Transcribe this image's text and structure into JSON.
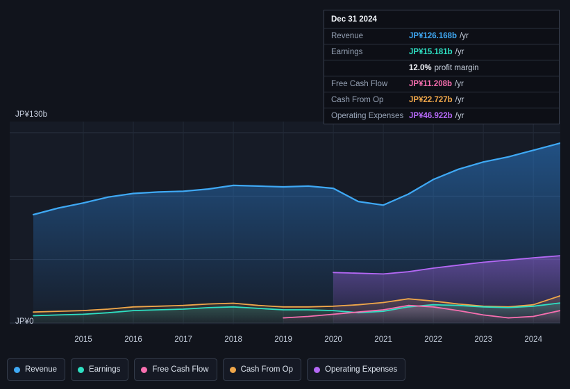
{
  "axis": {
    "y_top_label": "JP¥130b",
    "y_bottom_label": "JP¥0",
    "x_ticks": [
      "2015",
      "2016",
      "2017",
      "2018",
      "2019",
      "2020",
      "2021",
      "2022",
      "2023",
      "2024"
    ]
  },
  "tooltip": {
    "date": "Dec 31 2024",
    "rows": [
      {
        "label": "Revenue",
        "value": "JP¥126.168b",
        "unit": "/yr",
        "color": "#3fa9f5"
      },
      {
        "label": "Earnings",
        "value": "JP¥15.181b",
        "unit": "/yr",
        "color": "#2ee0c3"
      },
      {
        "label": "",
        "value": "12.0%",
        "unit": "profit margin",
        "color": "#f2f5fa"
      },
      {
        "label": "Free Cash Flow",
        "value": "JP¥11.208b",
        "unit": "/yr",
        "color": "#f86fb0"
      },
      {
        "label": "Cash From Op",
        "value": "JP¥22.727b",
        "unit": "/yr",
        "color": "#f0a74a"
      },
      {
        "label": "Operating Expenses",
        "value": "JP¥46.922b",
        "unit": "/yr",
        "color": "#b468f5"
      }
    ]
  },
  "legend": [
    {
      "label": "Revenue",
      "color": "#3fa9f5"
    },
    {
      "label": "Earnings",
      "color": "#2ee0c3"
    },
    {
      "label": "Free Cash Flow",
      "color": "#f86fb0"
    },
    {
      "label": "Cash From Op",
      "color": "#f0a74a"
    },
    {
      "label": "Operating Expenses",
      "color": "#b468f5"
    }
  ],
  "chart_data": {
    "type": "area",
    "title": "",
    "xlabel": "",
    "ylabel": "",
    "ylim": [
      0,
      130
    ],
    "y_unit": "JP¥ billions",
    "grid": true,
    "legend_position": "bottom-left",
    "x": [
      2014.0,
      2014.5,
      2015.0,
      2015.5,
      2016.0,
      2016.5,
      2017.0,
      2017.5,
      2018.0,
      2018.5,
      2019.0,
      2019.5,
      2020.0,
      2020.5,
      2021.0,
      2021.5,
      2022.0,
      2022.5,
      2023.0,
      2023.5,
      2024.0,
      2024.9
    ],
    "series": [
      {
        "name": "Revenue",
        "color": "#3fa9f5",
        "values": [
          74.0,
          78.5,
          82.0,
          86.0,
          88.5,
          89.5,
          90.0,
          91.5,
          94.0,
          93.5,
          93.0,
          93.5,
          92.0,
          83.0,
          80.5,
          88.0,
          98.0,
          105.0,
          110.0,
          113.5,
          118.0,
          126.168
        ]
      },
      {
        "name": "Earnings",
        "color": "#2ee0c3",
        "values": [
          5.0,
          5.5,
          6.0,
          7.0,
          8.5,
          9.0,
          9.5,
          10.5,
          11.0,
          10.0,
          9.0,
          9.0,
          8.5,
          7.0,
          8.0,
          11.0,
          12.5,
          12.0,
          11.0,
          10.5,
          11.5,
          15.181
        ]
      },
      {
        "name": "Free Cash Flow",
        "color": "#f86fb0",
        "values": [
          null,
          null,
          null,
          null,
          null,
          null,
          null,
          null,
          null,
          null,
          3.5,
          4.5,
          6.0,
          7.5,
          9.0,
          12.0,
          11.0,
          8.5,
          5.5,
          3.5,
          4.5,
          11.208
        ]
      },
      {
        "name": "Cash From Op",
        "color": "#f0a74a",
        "values": [
          7.5,
          8.0,
          8.5,
          9.5,
          11.0,
          11.5,
          12.0,
          13.0,
          13.5,
          12.0,
          11.0,
          11.0,
          11.5,
          12.5,
          14.0,
          16.5,
          15.0,
          13.0,
          11.5,
          11.0,
          12.5,
          22.727
        ]
      },
      {
        "name": "Operating Expenses",
        "color": "#b468f5",
        "values": [
          null,
          null,
          null,
          null,
          null,
          null,
          null,
          null,
          null,
          null,
          null,
          null,
          34.5,
          34.0,
          33.5,
          35.0,
          37.5,
          39.5,
          41.5,
          43.0,
          44.5,
          46.922
        ]
      }
    ]
  }
}
